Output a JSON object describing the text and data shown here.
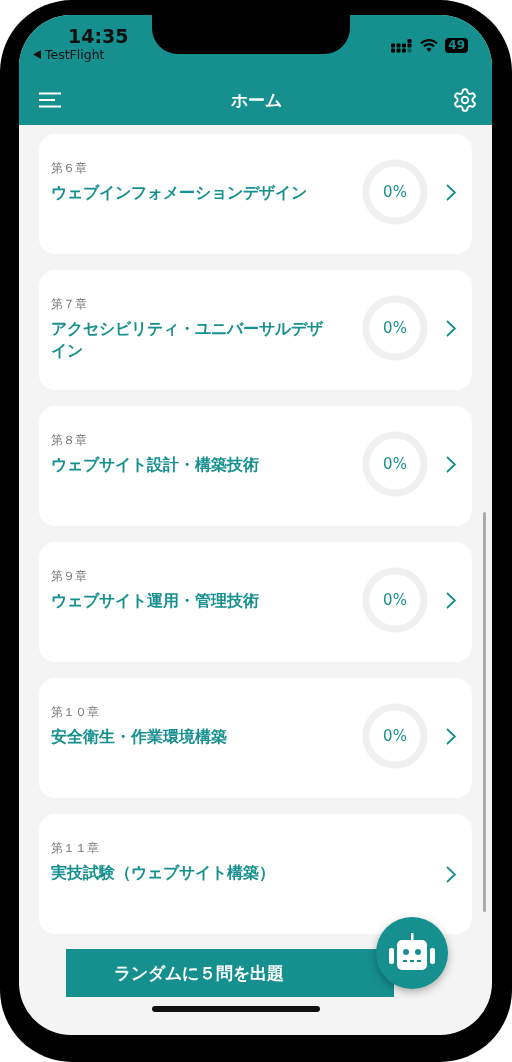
{
  "status_bar": {
    "time": "14:35",
    "back_app": "TestFlight",
    "battery": "49"
  },
  "header": {
    "title": "ホーム"
  },
  "chapters": [
    {
      "label": "第６章",
      "title": "ウェブインフォメーションデザイン",
      "kind": "progress",
      "level": 0,
      "percent": "0%"
    },
    {
      "label": "第７章",
      "title": "アクセシビリティ・ユニバーサルデザイン",
      "kind": "progress",
      "level": 0,
      "percent": "0%"
    },
    {
      "label": "第８章",
      "title": "ウェブサイト設計・構築技術",
      "kind": "progress",
      "level": 0,
      "percent": "0%"
    },
    {
      "label": "第９章",
      "title": "ウェブサイト運用・管理技術",
      "kind": "progress",
      "level": 0,
      "percent": "0%"
    },
    {
      "label": "第１０章",
      "title": "安全衛生・作業環境構築",
      "kind": "progress",
      "level": 0,
      "percent": "0%"
    },
    {
      "label": "第１１章",
      "title": "実技試験（ウェブサイト構築）",
      "kind": "plain"
    }
  ],
  "random_button": {
    "label": "ランダムに５問を出題"
  }
}
